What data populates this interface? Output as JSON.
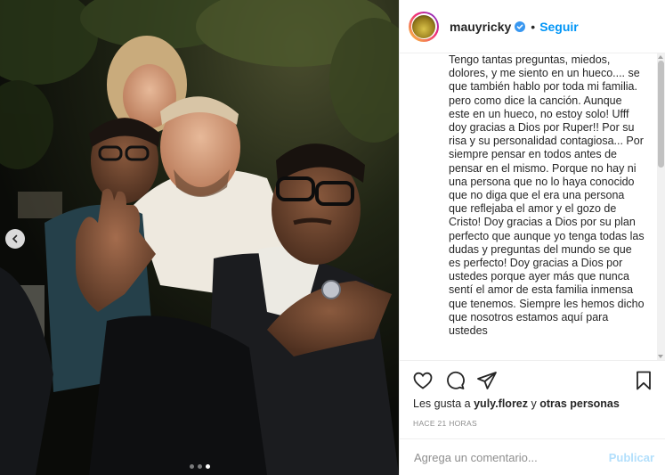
{
  "post": {
    "image_alt": "",
    "carousel": {
      "total": 3,
      "active_index": 2
    }
  },
  "header": {
    "username": "mauyricky",
    "separator": "•",
    "follow_label": "Seguir"
  },
  "caption": {
    "text": "Tengo tantas preguntas, miedos, dolores, y me siento en un hueco.... se que también hablo por toda mi familia. pero como dice la canción. Aunque este en un hueco, no estoy solo! Ufff doy gracias a Dios por Ruper!! Por su risa y su personalidad contagiosa... Por siempre pensar en todos antes de pensar en el mismo. Porque no hay ni una persona que no lo haya conocido que no diga que el era una persona que reflejaba el amor y el gozo de Cristo! Doy gracias a Dios por su plan perfecto que aunque yo tenga todas las dudas y preguntas del mundo se que es perfecto! Doy gracias a Dios por ustedes porque ayer más que nunca sentí el amor de esta familia inmensa que tenemos. Siempre les hemos dicho que nosotros estamos aquí para ustedes"
  },
  "actions": {
    "like_icon": "heart-icon",
    "comment_icon": "comment-icon",
    "share_icon": "paper-plane-icon",
    "save_icon": "bookmark-icon"
  },
  "likes": {
    "prefix": "Les gusta a ",
    "user": "yuly.florez",
    "middle": " y ",
    "others": "otras personas"
  },
  "timestamp": "HACE 21 HORAS",
  "comment": {
    "placeholder": "Agrega un comentario...",
    "value": "",
    "publish_label": "Publicar"
  },
  "colors": {
    "link": "#0095f6",
    "publish_disabled": "#b2dffc",
    "verified": "#3897f0",
    "muted": "#8e8e8e"
  }
}
